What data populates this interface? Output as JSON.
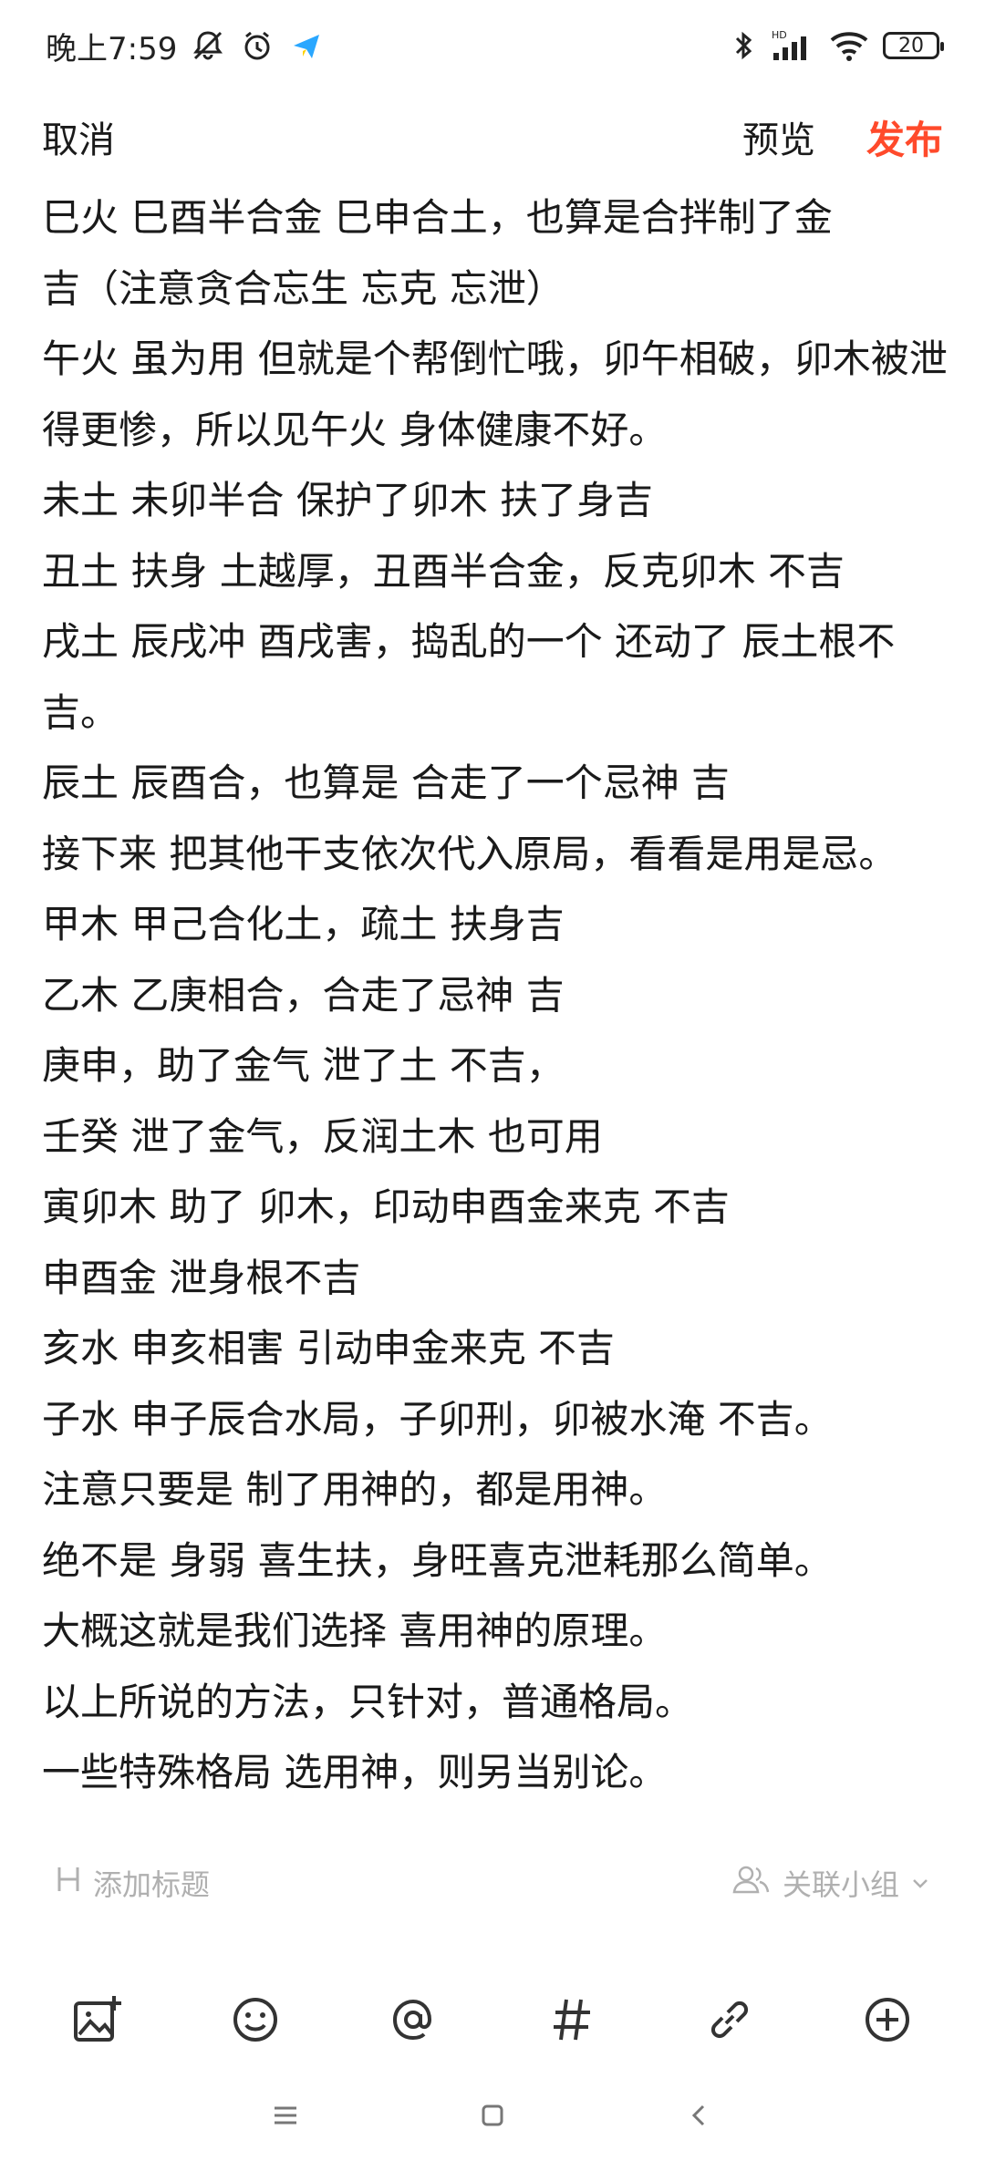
{
  "status_bar": {
    "time": "晚上7:59",
    "battery": "20",
    "signal_badge": "HD"
  },
  "top_bar": {
    "cancel_label": "取消",
    "preview_label": "预览",
    "publish_label": "发布",
    "publish_color": "#ff4a2b"
  },
  "content": {
    "lines": [
      "巳火 巳酉半合金 巳申合土，也算是合拌制了金",
      "吉（注意贪合忘生 忘克 忘泄）",
      "午火 虽为用 但就是个帮倒忙哦，卯午相破，卯木被泄得更惨，所以见午火 身体健康不好。",
      "未土 未卯半合 保护了卯木 扶了身吉",
      "丑土 扶身 土越厚，丑酉半合金，反克卯木 不吉",
      "戌土 辰戌冲 酉戌害，捣乱的一个 还动了 辰土根不吉。",
      "辰土 辰酉合，也算是 合走了一个忌神 吉",
      "接下来 把其他干支依次代入原局，看看是用是忌。",
      "甲木 甲己合化土，疏土 扶身吉",
      "乙木 乙庚相合，合走了忌神 吉",
      "庚申，助了金气 泄了土 不吉，",
      "壬癸 泄了金气，反润土木 也可用",
      "寅卯木 助了 卯木，印动申酉金来克 不吉",
      "申酉金 泄身根不吉",
      "亥水 申亥相害 引动申金来克 不吉",
      "子水 申子辰合水局，子卯刑，卯被水淹 不吉。",
      "注意只要是 制了用神的，都是用神。",
      "绝不是 身弱 喜生扶，身旺喜克泄耗那么简单。",
      "大概这就是我们选择 喜用神的原理。",
      "以上所说的方法，只针对，普通格局。",
      "一些特殊格局 选用神，则另当别论。"
    ]
  },
  "meta_row": {
    "add_title_label": "添加标题",
    "link_group_label": "关联小组"
  },
  "toolbar": {
    "icons": [
      "image-add-icon",
      "emoji-icon",
      "mention-icon",
      "hashtag-icon",
      "link-icon",
      "plus-circle-icon"
    ]
  },
  "nav_bar": {
    "icons": [
      "menu-icon",
      "home-square-icon",
      "back-chevron-icon"
    ]
  },
  "colors": {
    "text": "#1a1a1a",
    "muted": "#b0b0b0",
    "accent": "#ff4a2b"
  }
}
